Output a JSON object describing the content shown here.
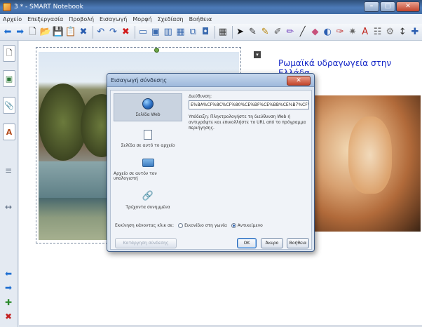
{
  "window": {
    "title": "3 * - SMART Notebook",
    "controls": {
      "minimize": "–",
      "maximize": "□",
      "close": "✕"
    }
  },
  "menu": [
    "Αρχείο",
    "Επεξεργασία",
    "Προβολή",
    "Εισαγωγή",
    "Μορφή",
    "Σχεδίαση",
    "Βοήθεια"
  ],
  "toolbar": {
    "icons": [
      {
        "name": "back-arrow-icon",
        "glyph": "⬅",
        "color": "#1f6fd1"
      },
      {
        "name": "forward-arrow-icon",
        "glyph": "➡",
        "color": "#1f6fd1"
      },
      {
        "name": "new-page-icon",
        "glyph": "🗋",
        "color": "#333"
      },
      {
        "name": "open-folder-icon",
        "glyph": "📂",
        "color": "#d99a22"
      },
      {
        "name": "save-icon",
        "glyph": "💾",
        "color": "#2a5db0"
      },
      {
        "name": "paste-icon",
        "glyph": "📋",
        "color": "#6b6b6b"
      },
      {
        "name": "delete-page-icon",
        "glyph": "✖",
        "color": "#2a5db0"
      },
      {
        "name": "undo-icon",
        "glyph": "↶",
        "color": "#2a5db0"
      },
      {
        "name": "redo-icon",
        "glyph": "↷",
        "color": "#2a5db0"
      },
      {
        "name": "delete-icon",
        "glyph": "✖",
        "color": "#d11b1b"
      },
      {
        "name": "screen-shade-icon",
        "glyph": "▭",
        "color": "#3b6bb0"
      },
      {
        "name": "full-screen-icon",
        "glyph": "▣",
        "color": "#3b6bb0"
      },
      {
        "name": "display-icon",
        "glyph": "▥",
        "color": "#3b6bb0"
      },
      {
        "name": "dual-page-icon",
        "glyph": "▦",
        "color": "#3b6bb0"
      },
      {
        "name": "screen-capture-icon",
        "glyph": "⧉",
        "color": "#3b6bb0"
      },
      {
        "name": "document-camera-icon",
        "glyph": "◘",
        "color": "#3b6bb0"
      },
      {
        "name": "table-icon",
        "glyph": "▦",
        "color": "#444"
      },
      {
        "name": "select-arrow-icon",
        "glyph": "➤",
        "color": "#111"
      },
      {
        "name": "pen-icon",
        "glyph": "✎",
        "color": "#333"
      },
      {
        "name": "creative-pen-icon",
        "glyph": "✎",
        "color": "#b8860b"
      },
      {
        "name": "highlighter-icon",
        "glyph": "✐",
        "color": "#555"
      },
      {
        "name": "magic-pen-icon",
        "glyph": "✏",
        "color": "#7a4cc2"
      },
      {
        "name": "line-icon",
        "glyph": "╱",
        "color": "#333"
      },
      {
        "name": "eraser-icon",
        "glyph": "◆",
        "color": "#c7507a"
      },
      {
        "name": "shapes-icon",
        "glyph": "◐",
        "color": "#2a5db0"
      },
      {
        "name": "fill-icon",
        "glyph": "✑",
        "color": "#c23a3a"
      },
      {
        "name": "magic-icon",
        "glyph": "✷",
        "color": "#666"
      },
      {
        "name": "text-icon",
        "glyph": "A",
        "color": "#c0261e"
      },
      {
        "name": "format-icon",
        "glyph": "☷",
        "color": "#555"
      },
      {
        "name": "properties-icon",
        "glyph": "⚙",
        "color": "#777"
      },
      {
        "name": "move-toolbar-icon",
        "glyph": "↕",
        "color": "#333"
      },
      {
        "name": "customize-icon",
        "glyph": "✚",
        "color": "#2a5db0"
      }
    ]
  },
  "sidebar": {
    "tabs": [
      {
        "name": "page-sorter-tab",
        "glyph": "🗋"
      },
      {
        "name": "gallery-tab",
        "glyph": "▣"
      },
      {
        "name": "attachments-tab",
        "glyph": "📎"
      },
      {
        "name": "properties-tab",
        "glyph": "A"
      }
    ],
    "grip": "≡",
    "collapse": "↔",
    "bottom": [
      {
        "name": "previous-page-icon",
        "glyph": "⬅"
      },
      {
        "name": "next-page-icon",
        "glyph": "➡"
      },
      {
        "name": "add-page-icon",
        "glyph": "✚"
      },
      {
        "name": "delete-page-side-icon",
        "glyph": "✖"
      }
    ]
  },
  "canvas": {
    "page_title": "Ρωμαϊκά υδραγωγεία στην Ελλάδα",
    "selection_menu": "▾"
  },
  "dialog": {
    "title": "Εισαγωγή σύνδεσης",
    "close": "✕",
    "nav": [
      {
        "label": "Σελίδα Web",
        "icon": "globe"
      },
      {
        "label": "Σελίδα σε αυτό το αρχείο",
        "icon": "file"
      },
      {
        "label": "Αρχείο σε αυτόν τον υπολογιστή",
        "icon": "folder"
      },
      {
        "label": "Τρέχοντα συνημμένα",
        "icon": "attachment"
      }
    ],
    "address_label": "Διεύθυνση:",
    "address_value": "E%BA%CF%8C%CF%80%CE%BF%CE%BB%CE%B7%CF%82#cite_note-0",
    "hint": "Υπόδειξη: Πληκτρολογήστε τη διεύθυνση Web ή αντιγράψτε και επικολλήστε το URL από το πρόγραμμα περιήγησης.",
    "launch_label": "Εκκίνηση κάνοντας κλικ σε:",
    "launch_option_corner": "Εικονίδιο στη γωνία",
    "launch_option_object": "Αντικείμενο",
    "remove_link": "Κατάργηση σύνδεσης",
    "ok": "OK",
    "cancel": "Άκυρο",
    "help": "Βοήθεια"
  }
}
